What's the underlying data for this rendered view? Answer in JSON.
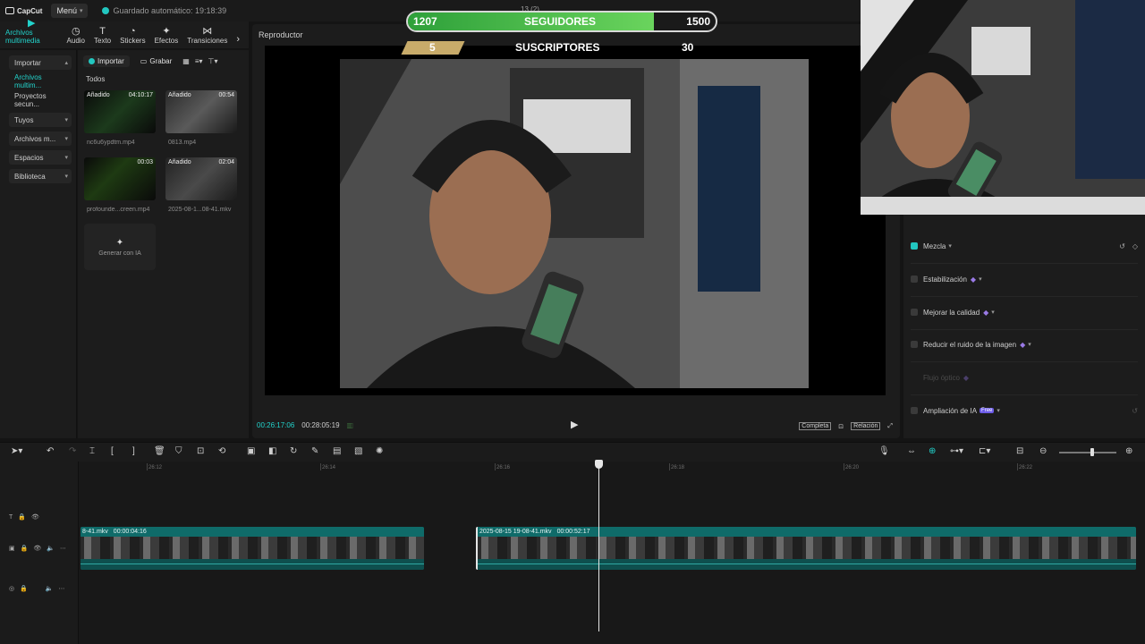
{
  "topbar": {
    "logo": "CapCut",
    "menu_label": "Menú",
    "autosave": "Guardado automático: 19:18:39",
    "center_title": "13 (2)"
  },
  "tooltabs": [
    {
      "label": "Archivos multimedia",
      "icon": "media-icon",
      "glyph": "▶"
    },
    {
      "label": "Audio",
      "icon": "audio-icon",
      "glyph": "◷"
    },
    {
      "label": "Texto",
      "icon": "text-icon",
      "glyph": "T"
    },
    {
      "label": "Stickers",
      "icon": "sticker-icon",
      "glyph": "◔"
    },
    {
      "label": "Efectos",
      "icon": "effects-icon",
      "glyph": "✦"
    },
    {
      "label": "Transiciones",
      "icon": "transitions-icon",
      "glyph": "⋈"
    }
  ],
  "sidebar": {
    "items": [
      {
        "label": "Importar",
        "chev": "^"
      },
      {
        "label": "Archivos multim...",
        "chev": ""
      },
      {
        "label": "Proyectos secun...",
        "chev": ""
      },
      {
        "label": "Tuyos",
        "chev": "v"
      },
      {
        "label": "Archivos m...",
        "chev": "v"
      },
      {
        "label": "Espacios",
        "chev": "v"
      },
      {
        "label": "Biblioteca",
        "chev": "v"
      }
    ]
  },
  "media": {
    "import_label": "Importar",
    "record_label": "Grabar",
    "section": "Todos",
    "items": [
      {
        "badge": "Añadido",
        "duration": "04:10:17",
        "name": "nc6u6ypdtm.mp4"
      },
      {
        "badge": "Añadido",
        "duration": "00:54",
        "name": "0813.mp4"
      },
      {
        "badge": "",
        "duration": "00:03",
        "name": "profounde...creen.mp4"
      },
      {
        "badge": "Añadido",
        "duration": "02:04",
        "name": "2025-08-1...08-41.mkv"
      }
    ],
    "generate_label": "Generar con IA"
  },
  "player": {
    "title": "Reproductor",
    "current_time": "00:26:17:06",
    "total_time": "00:28:05:19",
    "full_label": "Completa",
    "ratio_label": "Relación"
  },
  "overlay": {
    "followers_current": "1207",
    "followers_label": "SEGUIDORES",
    "followers_goal": "1500",
    "followers_progress": 0.8,
    "subs_current": "5",
    "subs_label": "SUSCRIPTORES",
    "subs_goal": "30"
  },
  "rightpanel": {
    "rows": [
      {
        "label": "Mezcla",
        "checked": true,
        "vip": false,
        "free": false,
        "dim": false
      },
      {
        "label": "Estabilización",
        "checked": false,
        "vip": true,
        "free": false,
        "dim": false
      },
      {
        "label": "Mejorar la calidad",
        "checked": false,
        "vip": true,
        "free": false,
        "dim": false
      },
      {
        "label": "Reducir el ruido de la imagen",
        "checked": false,
        "vip": true,
        "free": false,
        "dim": false
      },
      {
        "label": "Flujo óptico",
        "checked": false,
        "vip": true,
        "free": false,
        "dim": true
      },
      {
        "label": "Ampliación de IA",
        "checked": false,
        "vip": false,
        "free": true,
        "dim": false
      }
    ],
    "free_label": "Free"
  },
  "timeline": {
    "ruler": [
      "26:12",
      "26:14",
      "26:16",
      "26:18",
      "26:20",
      "26:22"
    ],
    "clip1": {
      "name": "8-41.mkv",
      "duration": "00:00:04:16"
    },
    "clip2": {
      "name": "2025-08-15 19-08-41.mkv",
      "duration": "00:00:52:17"
    }
  }
}
